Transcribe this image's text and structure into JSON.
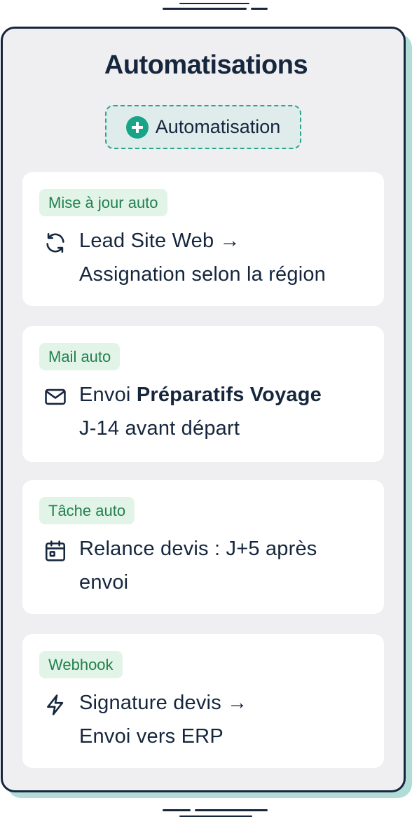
{
  "title": "Automatisations",
  "add_button": {
    "label": "Automatisation",
    "icon": "plus-circle-icon"
  },
  "automations": [
    {
      "badge": "Mise à jour auto",
      "icon": "refresh-icon",
      "line1": "Lead Site Web →",
      "line2": "Assignation selon la région"
    },
    {
      "badge": "Mail auto",
      "icon": "mail-icon",
      "line1_prefix": "Envoi",
      "line1_bold": "Préparatifs Voyage",
      "line2": "J-14 avant départ"
    },
    {
      "badge": "Tâche auto",
      "icon": "calendar-icon",
      "line1": "Relance devis : J+5 après",
      "line2": "envoi"
    },
    {
      "badge": "Webhook",
      "icon": "lightning-icon",
      "line1": "Signature devis →",
      "line2": "Envoi vers ERP"
    }
  ],
  "colors": {
    "navy": "#15263d",
    "accent": "#17a488",
    "badge_bg": "#e2f4e8",
    "badge_text": "#23804f",
    "panel_bg": "#efeff1"
  }
}
